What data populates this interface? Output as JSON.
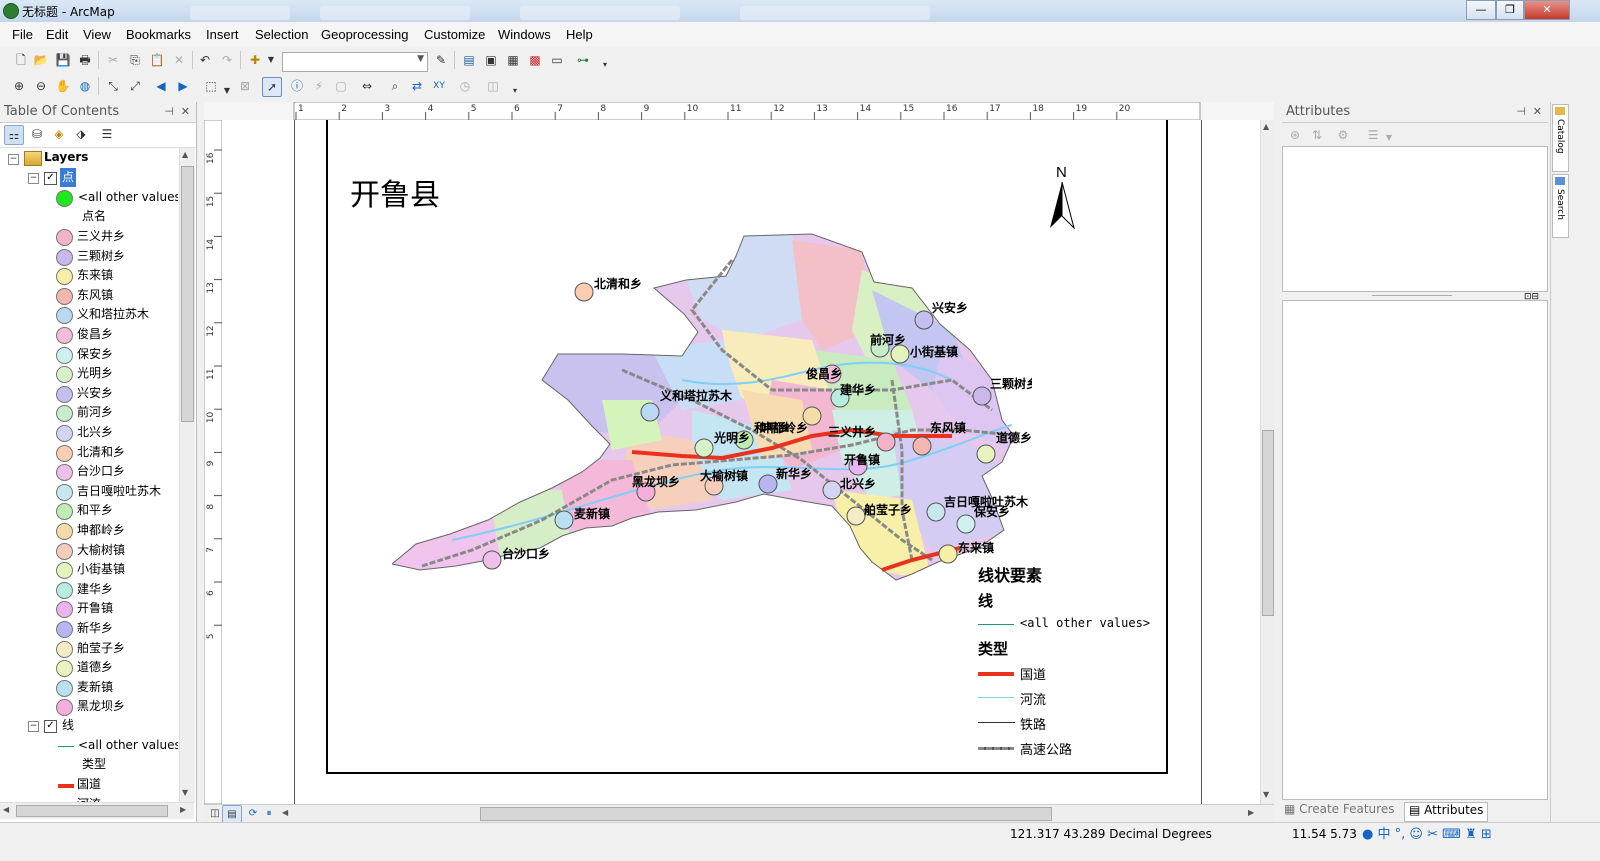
{
  "window": {
    "title": "无标题 - ArcMap",
    "buttons": [
      "—",
      "❐",
      "✕"
    ]
  },
  "menu": [
    "File",
    "Edit",
    "View",
    "Bookmarks",
    "Insert",
    "Selection",
    "Geoprocessing",
    "Customize",
    "Windows",
    "Help"
  ],
  "toc": {
    "title": "Table Of Contents",
    "root": "Layers",
    "point_layer": {
      "name": "点",
      "default_label": "<all other values>",
      "default_color": "#1ee81e",
      "field": "点名",
      "items": [
        {
          "label": "三义井乡",
          "color": "#f4b3c8"
        },
        {
          "label": "三颗树乡",
          "color": "#c8b8ec"
        },
        {
          "label": "东来镇",
          "color": "#f6f0a6"
        },
        {
          "label": "东风镇",
          "color": "#f3b6b0"
        },
        {
          "label": "义和塔拉苏木",
          "color": "#b9d8f4"
        },
        {
          "label": "俊昌乡",
          "color": "#f3bcd8"
        },
        {
          "label": "保安乡",
          "color": "#d0f0f0"
        },
        {
          "label": "光明乡",
          "color": "#d6f1c8"
        },
        {
          "label": "兴安乡",
          "color": "#c4c0ee"
        },
        {
          "label": "前河乡",
          "color": "#c6eccc"
        },
        {
          "label": "北兴乡",
          "color": "#d4d4f2"
        },
        {
          "label": "北清和乡",
          "color": "#f8cdb2"
        },
        {
          "label": "台沙口乡",
          "color": "#eebfe8"
        },
        {
          "label": "吉日嘎啦吐苏木",
          "color": "#c7e6ee"
        },
        {
          "label": "和平乡",
          "color": "#c0ecb4"
        },
        {
          "label": "坤都岭乡",
          "color": "#f4dca8"
        },
        {
          "label": "大榆树镇",
          "color": "#f6cdbb"
        },
        {
          "label": "小街基镇",
          "color": "#e2f4bc"
        },
        {
          "label": "建华乡",
          "color": "#b7ecdf"
        },
        {
          "label": "开鲁镇",
          "color": "#e9b4ef"
        },
        {
          "label": "新华乡",
          "color": "#b8b6f2"
        },
        {
          "label": "舶莹子乡",
          "color": "#f6ecc4"
        },
        {
          "label": "道德乡",
          "color": "#e8f4c0"
        },
        {
          "label": "麦新镇",
          "color": "#b9e0ee"
        },
        {
          "label": "黑龙坝乡",
          "color": "#f4b0da"
        }
      ]
    },
    "line_layer": {
      "name": "线",
      "default_label": "<all other values>",
      "field": "类型",
      "items": [
        {
          "label": "国道",
          "color": "#e8321e"
        },
        {
          "label": "河流",
          "color": "#7fd0f4"
        }
      ]
    }
  },
  "map": {
    "title": "开鲁县",
    "north": "N",
    "ruler_top": [
      "1",
      "2",
      "3",
      "4",
      "5",
      "6",
      "7",
      "8",
      "9",
      "10",
      "11",
      "12",
      "13",
      "14",
      "15",
      "16",
      "17",
      "18",
      "19",
      "20"
    ],
    "ruler_left": [
      "16",
      "15",
      "14",
      "13",
      "12",
      "11",
      "10",
      "9",
      "8",
      "7",
      "6",
      "5"
    ],
    "place_labels": [
      "北清和乡",
      "兴安乡",
      "前河乡",
      "小街基镇",
      "俊昌乡",
      "建华乡",
      "三颗树乡",
      "义和塔拉苏木",
      "坤都岭乡",
      "和平乡",
      "东风镇",
      "三义井乡",
      "道德乡",
      "光明乡",
      "开鲁镇",
      "黑龙坝乡",
      "大榆树镇",
      "新华乡",
      "北兴乡",
      "吉日嘎啦吐苏木",
      "舶莹子乡",
      "保安乡",
      "麦新镇",
      "台沙口乡",
      "东来镇"
    ],
    "legend": {
      "title": "线状要素",
      "layer": "线",
      "default_label": "<all other values>",
      "field": "类型",
      "items": [
        {
          "label": "国道",
          "color": "#e8321e"
        },
        {
          "label": "河流",
          "color": "#7fd0f4"
        },
        {
          "label": "铁路",
          "color": "#333333"
        },
        {
          "label": "高速公路",
          "color": "#888888"
        }
      ]
    }
  },
  "attributes": {
    "title": "Attributes",
    "side_tabs": [
      "Catalog",
      "Search"
    ],
    "bottom_tabs": [
      "Create Features",
      "Attributes"
    ]
  },
  "status": {
    "coords": "121.317  43.289 Decimal Degrees",
    "page": "11.54  5.73"
  }
}
